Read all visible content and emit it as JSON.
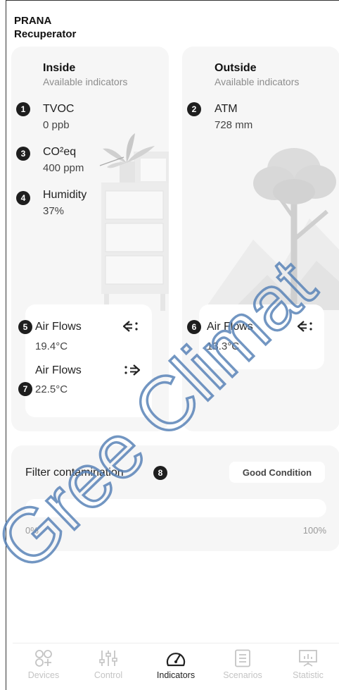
{
  "app": {
    "title_line1": "PRANA",
    "title_line2": "Recuperator"
  },
  "inside": {
    "title": "Inside",
    "subtitle": "Available indicators",
    "indicators": [
      {
        "badge": "1",
        "label": "TVOC",
        "value": "0 ppb"
      },
      {
        "badge": "3",
        "label": "CO²eq",
        "value": "400 ppm"
      },
      {
        "badge": "4",
        "label": "Humidity",
        "value": "37%"
      }
    ],
    "air_flows": [
      {
        "badge": "5",
        "label": "Air Flows",
        "value": "19.4°C",
        "icon": "arrow-in-icon"
      },
      {
        "badge": "7",
        "label": "Air Flows",
        "value": "22.5°C",
        "icon": "arrow-out-icon"
      }
    ]
  },
  "outside": {
    "title": "Outside",
    "subtitle": "Available indicators",
    "indicators": [
      {
        "badge": "2",
        "label": "ATM",
        "value": "728 mm"
      }
    ],
    "air_flows": [
      {
        "badge": "6",
        "label": "Air Flows",
        "value": "13.3°C",
        "icon": "arrow-in-icon"
      }
    ]
  },
  "filter": {
    "title": "Filter contamination",
    "badge": "8",
    "status": "Good Condition",
    "min_label": "0%",
    "max_label": "100%",
    "contamination_fraction": 0
  },
  "nav": {
    "items": [
      {
        "label": "Devices",
        "icon": "devices-icon",
        "active": false
      },
      {
        "label": "Control",
        "icon": "sliders-icon",
        "active": false
      },
      {
        "label": "Indicators",
        "icon": "gauge-icon",
        "active": true
      },
      {
        "label": "Scenarios",
        "icon": "list-icon",
        "active": false
      },
      {
        "label": "Statistic",
        "icon": "chart-icon",
        "active": false
      }
    ]
  },
  "watermark": {
    "text": "Gree Climat",
    "color": "#5a84b8"
  }
}
